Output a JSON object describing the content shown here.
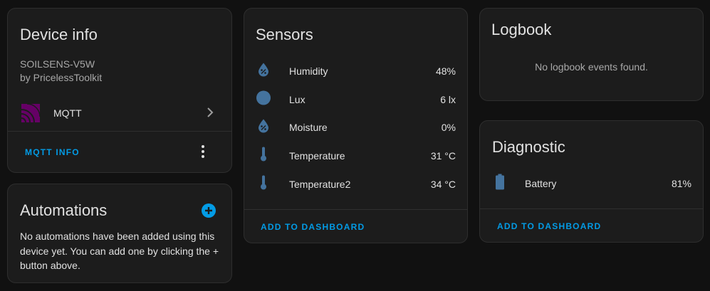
{
  "device_info": {
    "title": "Device info",
    "model": "SOILSENS-V5W",
    "manufacturer": "by PricelessToolkit",
    "integration": {
      "label": "MQTT",
      "icon": "mqtt-icon"
    },
    "action_label": "MQTT INFO",
    "colors": {
      "mqtt": "#660066"
    }
  },
  "automations": {
    "title": "Automations",
    "text": "No automations have been added using this device yet. You can add one by clicking the + button above."
  },
  "sensors": {
    "title": "Sensors",
    "items": [
      {
        "name": "Humidity",
        "value": "48%",
        "icon": "water-percent-icon"
      },
      {
        "name": "Lux",
        "value": "6 lx",
        "icon": "circle-icon"
      },
      {
        "name": "Moisture",
        "value": "0%",
        "icon": "water-percent-icon"
      },
      {
        "name": "Temperature",
        "value": "31 °C",
        "icon": "thermometer-icon"
      },
      {
        "name": "Temperature2",
        "value": "34 °C",
        "icon": "thermometer-icon"
      }
    ],
    "action_label": "ADD TO DASHBOARD"
  },
  "logbook": {
    "title": "Logbook",
    "empty_text": "No logbook events found."
  },
  "diagnostic": {
    "title": "Diagnostic",
    "items": [
      {
        "name": "Battery",
        "value": "81%",
        "icon": "battery-icon"
      }
    ],
    "action_label": "ADD TO DASHBOARD"
  },
  "colors": {
    "accent": "#039be5",
    "icon": "#44739e"
  }
}
